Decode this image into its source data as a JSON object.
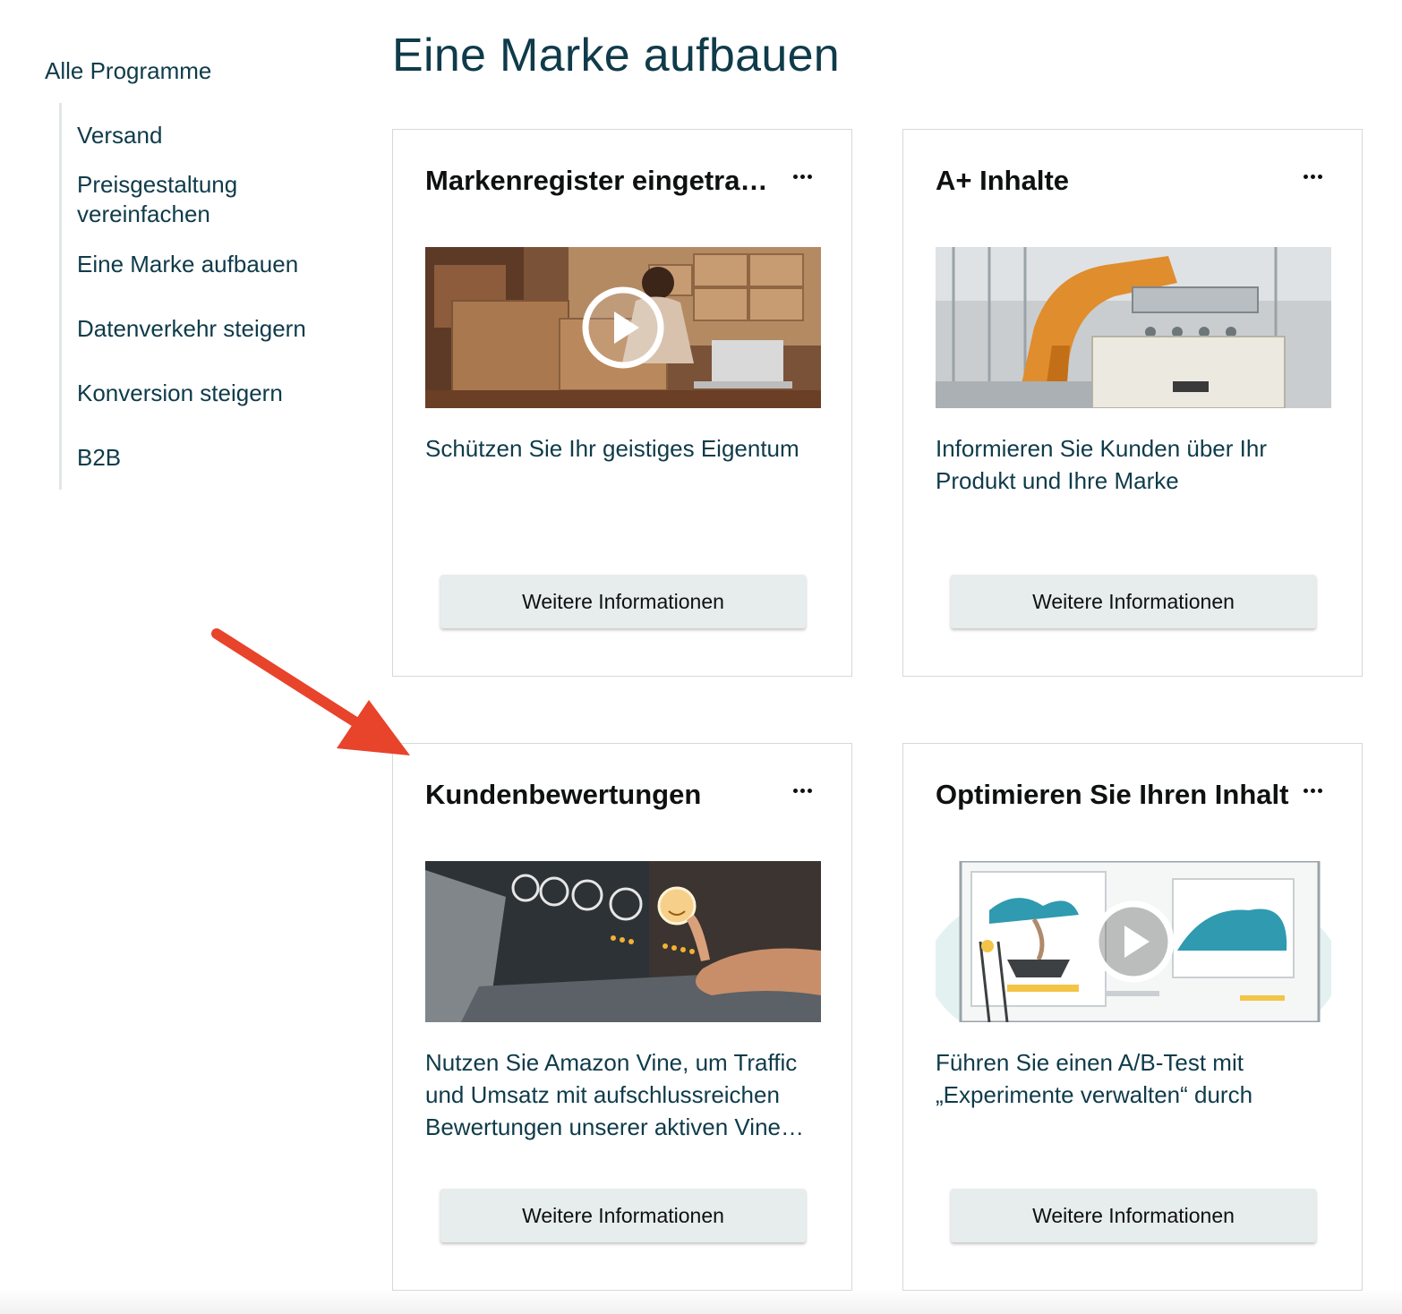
{
  "sidebar": {
    "title": "Alle Programme",
    "items": [
      {
        "label": "Versand"
      },
      {
        "label": "Preisgestaltung vereinfachen"
      },
      {
        "label": "Eine Marke aufbauen"
      },
      {
        "label": "Datenverkehr steigern"
      },
      {
        "label": "Konversion steigern"
      },
      {
        "label": "B2B"
      }
    ]
  },
  "main": {
    "title": "Eine Marke aufbauen",
    "cards": [
      {
        "title": "Markenregister eingetragen",
        "description": "Schützen Sie Ihr geistiges Eigentum",
        "button": "Weitere Informationen",
        "media_icon": "play-icon"
      },
      {
        "title": "A+ Inhalte",
        "description": "Informieren Sie Kunden über Ihr Produkt und Ihre Marke",
        "button": "Weitere Informationen"
      },
      {
        "title": "Kundenbewertungen",
        "description": "Nutzen Sie Amazon Vine, um Traffic und Umsatz mit aufschlussreichen Bewertungen unserer aktiven Vine Voices zu steigern",
        "button": "Weitere Informationen"
      },
      {
        "title": "Optimieren Sie Ihren Inhalt",
        "description": "Führen Sie einen A/B-Test mit „Experimente verwalten“ durch",
        "button": "Weitere Informationen",
        "media_icon": "play-icon"
      }
    ]
  },
  "colors": {
    "heading": "#0f3b4a",
    "button_bg": "#e7ecec",
    "card_border": "#d5d9d9",
    "arrow": "#e8432b"
  }
}
